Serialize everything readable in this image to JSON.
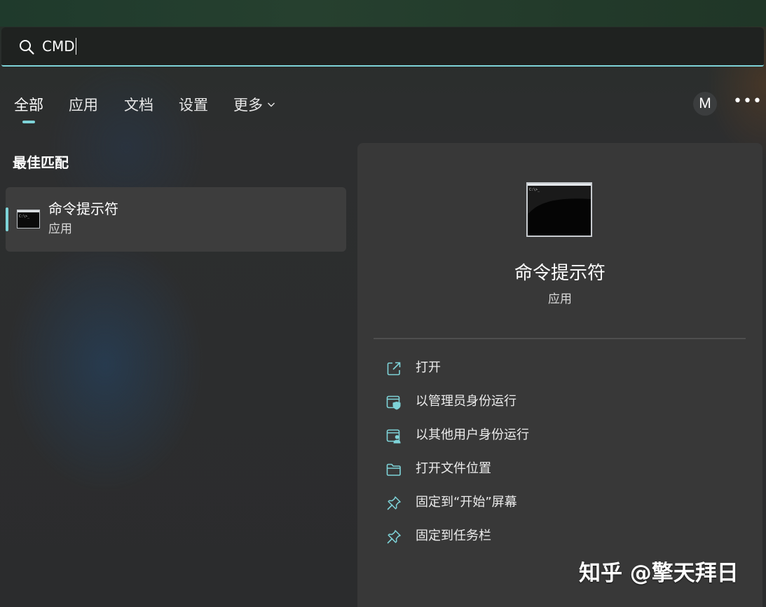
{
  "search": {
    "query": "CMD"
  },
  "tabs": [
    {
      "label": "全部",
      "active": true
    },
    {
      "label": "应用",
      "active": false
    },
    {
      "label": "文档",
      "active": false
    },
    {
      "label": "设置",
      "active": false
    },
    {
      "label": "更多",
      "active": false
    }
  ],
  "account": {
    "initial": "M",
    "more_label": "•••"
  },
  "best_match": {
    "title": "最佳匹配",
    "item": {
      "name": "命令提示符",
      "type": "应用",
      "icon": "cmd-window-icon"
    }
  },
  "detail": {
    "name": "命令提示符",
    "type": "应用",
    "icon": "cmd-window-icon",
    "actions": [
      {
        "label": "打开",
        "icon": "open-external-icon"
      },
      {
        "label": "以管理员身份运行",
        "icon": "shield-window-icon"
      },
      {
        "label": "以其他用户身份运行",
        "icon": "user-window-icon"
      },
      {
        "label": "打开文件位置",
        "icon": "folder-icon"
      },
      {
        "label": "固定到“开始”屏幕",
        "icon": "pin-icon"
      },
      {
        "label": "固定到任务栏",
        "icon": "pin-icon"
      }
    ]
  },
  "watermark": {
    "text": "知乎 @擎天拜日"
  },
  "colors": {
    "accent": "#7ed3d8",
    "background": "#2d2e2f",
    "panel": "#383838",
    "selected_item": "#3d3d3d"
  }
}
